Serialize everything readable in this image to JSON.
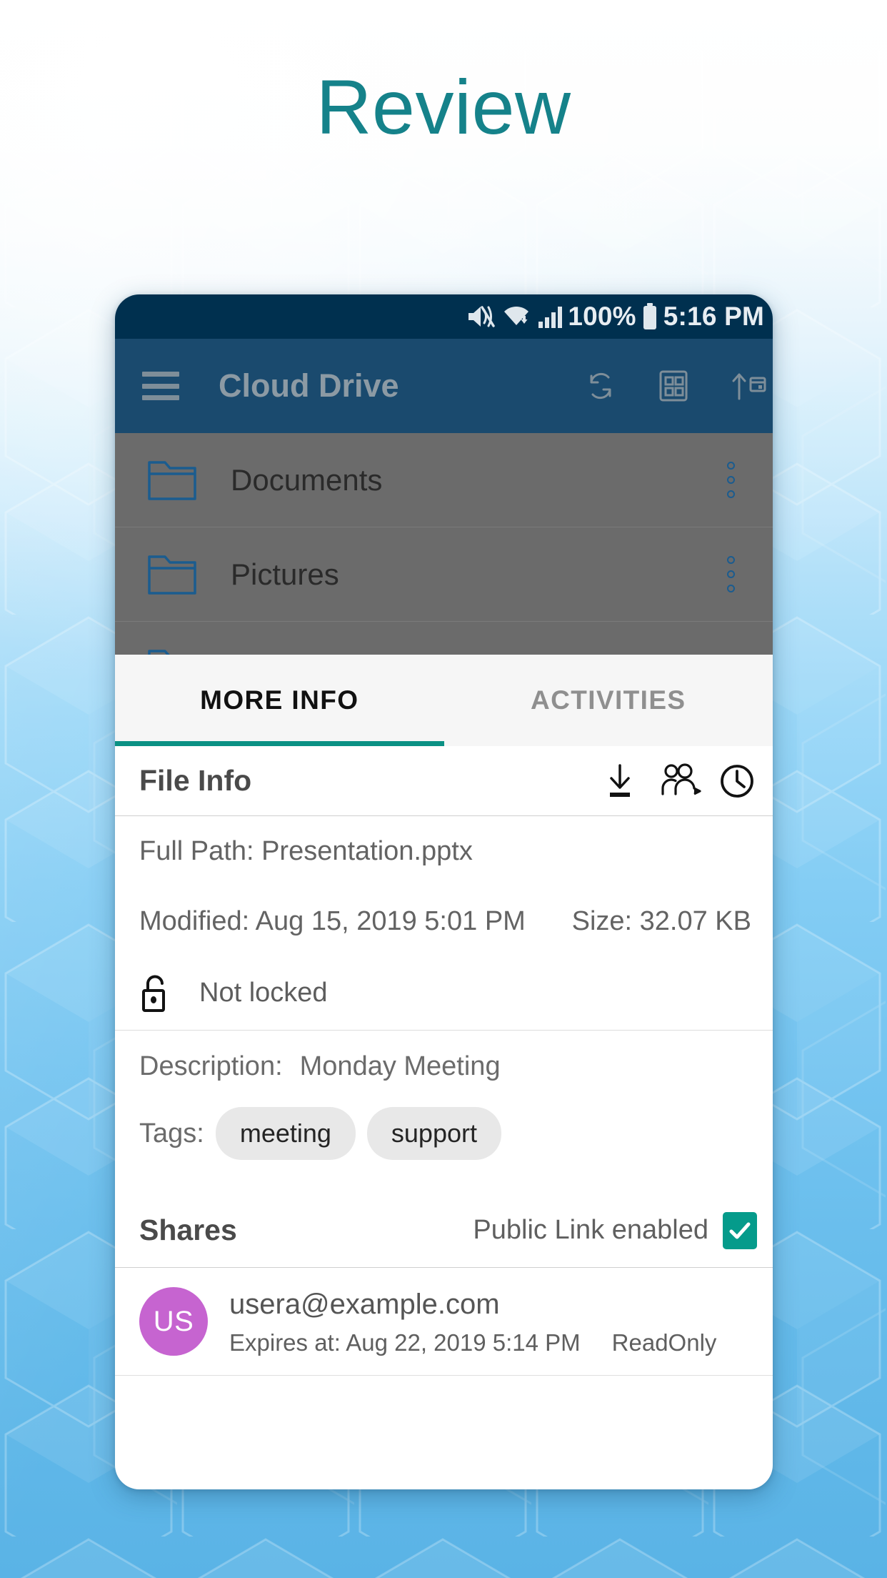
{
  "page": {
    "title": "Review",
    "title_color": "#15828a",
    "background": {
      "top_color": "#ffffff",
      "bottom_color": "#5ab3e6",
      "pattern": "hexagon"
    }
  },
  "phone": {
    "status_bar": {
      "background": "#00304f",
      "icons": [
        "mute-icon",
        "wifi-icon",
        "signal-icon"
      ],
      "battery_percent": "100%",
      "battery_icon": "battery-icon",
      "time": "5:16 PM"
    },
    "app_bar": {
      "background": "#1a4a6e",
      "menu_icon": "hamburger-menu-icon",
      "title": "Cloud Drive",
      "actions": [
        {
          "name": "sync-icon"
        },
        {
          "name": "grid-view-icon"
        },
        {
          "name": "upload-icon"
        }
      ]
    },
    "file_list": {
      "dimmed": true,
      "scrim_color": "#6b6b6b",
      "items": [
        {
          "icon": "folder-icon",
          "name": "Documents",
          "menu": "kebab-menu-icon"
        },
        {
          "icon": "folder-icon",
          "name": "Pictures",
          "menu": "kebab-menu-icon"
        }
      ]
    },
    "sheet": {
      "tabs": [
        {
          "label": "MORE INFO",
          "active": true
        },
        {
          "label": "ACTIVITIES",
          "active": false
        }
      ],
      "active_tab_accent": "#0b9184",
      "file_info": {
        "heading": "File Info",
        "actions": [
          {
            "name": "download-icon"
          },
          {
            "name": "share-people-icon"
          },
          {
            "name": "history-clock-icon"
          }
        ],
        "full_path": "Full Path: Presentation.pptx",
        "modified": "Modified: Aug 15, 2019 5:01 PM",
        "size": "Size: 32.07 KB",
        "lock_icon": "unlock-icon",
        "lock_status": "Not locked"
      },
      "description": {
        "label": "Description:",
        "value": "Monday Meeting"
      },
      "tags": {
        "label": "Tags:",
        "items": [
          "meeting",
          "support"
        ]
      },
      "shares": {
        "heading": "Shares",
        "public_link_label": "Public Link enabled",
        "public_link_enabled": true,
        "checkbox_color": "#059b8b",
        "entries": [
          {
            "initials": "US",
            "avatar_color": "#c664d0",
            "email": "usera@example.com",
            "expires": "Expires at: Aug 22, 2019 5:14 PM",
            "permission": "ReadOnly"
          }
        ]
      }
    }
  }
}
